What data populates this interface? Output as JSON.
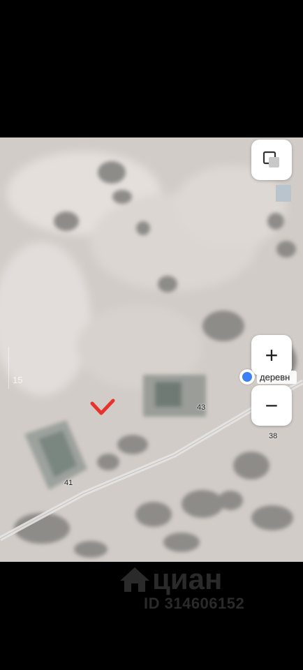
{
  "map": {
    "controls": {
      "layers_icon": "layers-icon",
      "zoom_in_label": "+",
      "zoom_out_label": "−"
    },
    "place": {
      "name": "деревн",
      "marker_color": "#3d7ff5"
    },
    "plot_numbers": {
      "a": "43",
      "b": "41",
      "c": "38"
    },
    "faint_label": "15",
    "mark": {
      "icon": "checkmark-icon",
      "color": "#e8322c"
    }
  },
  "watermark": {
    "brand": "циан",
    "listing_id": "ID 314606152"
  }
}
